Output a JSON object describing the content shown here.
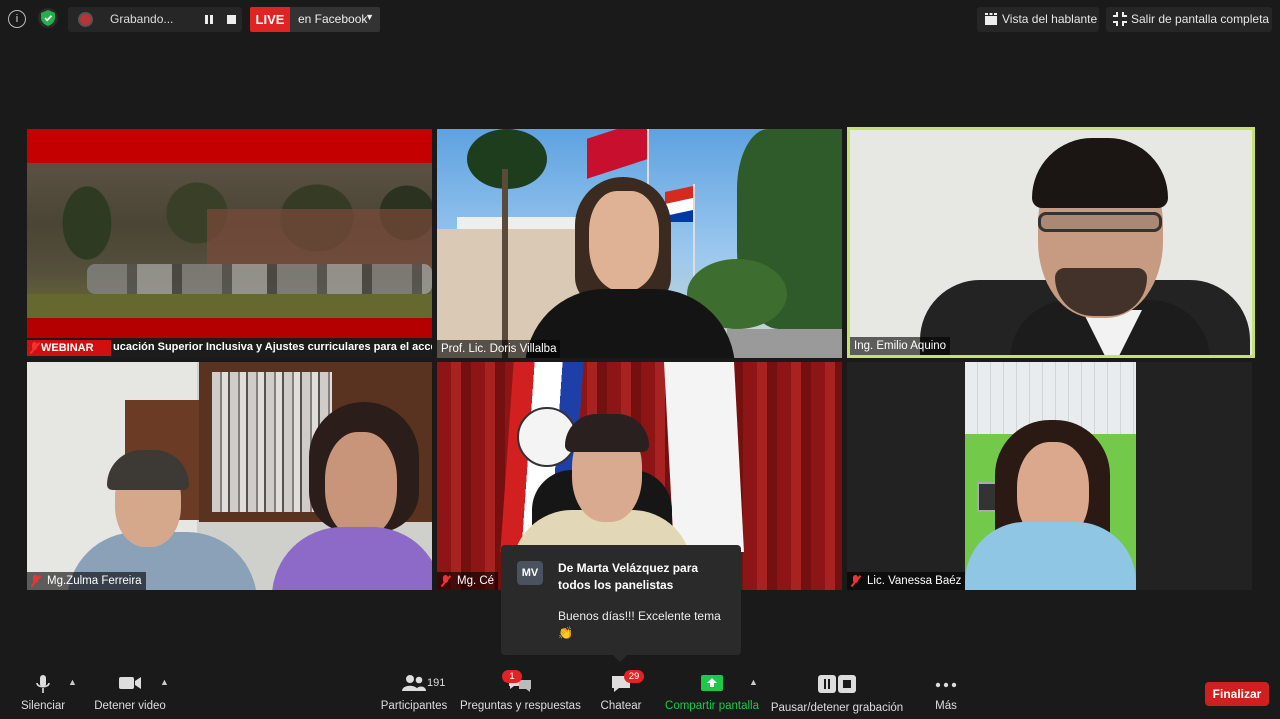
{
  "topbar": {
    "recording_label": "Grabando...",
    "live_badge": "LIVE",
    "stream_target": "en Facebook",
    "speaker_view_label": "Vista del hablante",
    "exit_fullscreen_label": "Salir de pantalla completa"
  },
  "tiles": [
    {
      "name": "",
      "ticker_badge": "WEBINAR",
      "ticker_text": "ucación Superior Inclusiva y Ajustes curriculares para el acceso a la"
    },
    {
      "name": "Prof. Lic. Doris Villalba"
    },
    {
      "name": "Ing. Emilio Aquino"
    },
    {
      "name": "Mg.Zulma Ferreira"
    },
    {
      "name": "Mg.  Cé"
    },
    {
      "name": "Lic. Vanessa Baéz"
    }
  ],
  "chat_popup": {
    "avatar_initials": "MV",
    "from": "De Marta Velázquez para todos los panelistas",
    "message": "Buenos días!!! Excelente tema👏"
  },
  "toolbar": {
    "mute_label": "Silenciar",
    "stop_video_label": "Detener video",
    "participants_label": "Participantes",
    "participants_count": "191",
    "qa_label": "Preguntas y respuestas",
    "qa_badge": "1",
    "chat_label": "Chatear",
    "chat_badge": "29",
    "share_label": "Compartir pantalla",
    "pause_record_label": "Pausar/detener grabación",
    "more_label": "Más",
    "end_label": "Finalizar"
  },
  "colors": {
    "background": "#1a1a1a",
    "live_red": "#e02424",
    "active_speaker_border": "#c6e26a",
    "share_green": "#1ec84a",
    "end_red": "#cf1f1f"
  }
}
